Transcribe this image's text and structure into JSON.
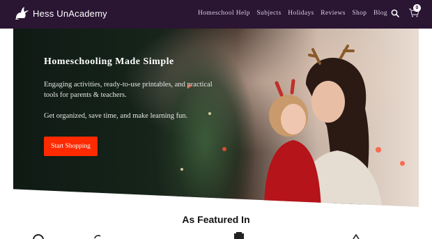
{
  "header": {
    "brand": "Hess UnAcademy",
    "nav": [
      {
        "label": "Homeschool Help"
      },
      {
        "label": "Subjects"
      },
      {
        "label": "Holidays"
      },
      {
        "label": "Reviews"
      },
      {
        "label": "Shop"
      },
      {
        "label": "Blog"
      }
    ],
    "cart_count": "0"
  },
  "hero": {
    "title": "Homeschooling Made Simple",
    "description": "Engaging activities, ready-to-use printables, and practical tools for parents & teachers.",
    "subtext": "Get organized, save time, and make learning fun.",
    "cta_label": "Start Shopping"
  },
  "featured": {
    "heading": "As Featured In"
  },
  "colors": {
    "header_bg": "#2a1533",
    "cta": "#ff2a00"
  },
  "icons": {
    "logo": "rabbit-icon",
    "search": "search-icon",
    "cart": "cart-icon"
  }
}
